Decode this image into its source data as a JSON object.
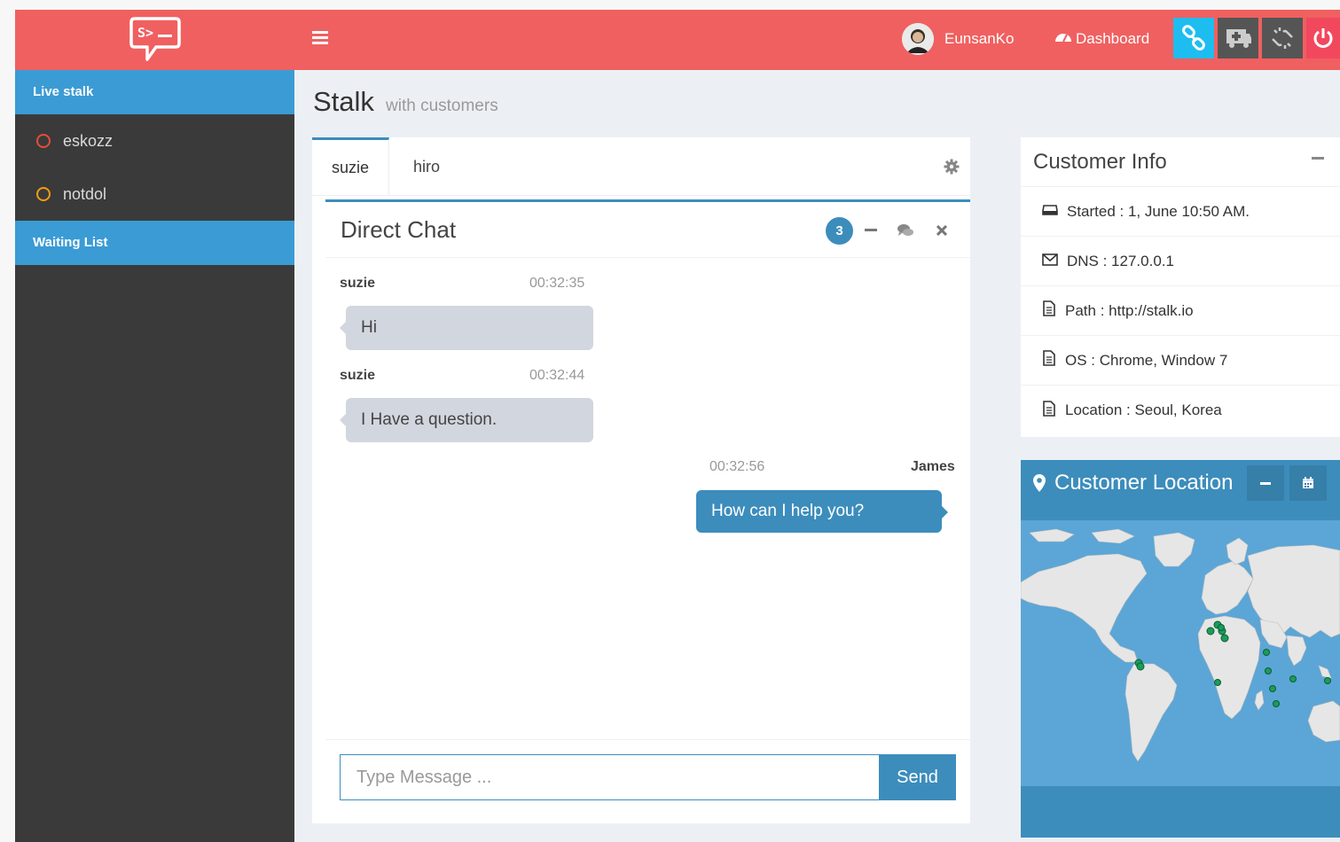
{
  "header": {
    "user_name": "EunsanKo",
    "dashboard_label": "Dashboard",
    "accent_color": "#f06060"
  },
  "sidebar": {
    "live_stalk_label": "Live stalk",
    "users": [
      {
        "name": "eskozz",
        "status_color": "#e74c3c"
      },
      {
        "name": "notdol",
        "status_color": "#f39c12"
      }
    ],
    "waiting_list_label": "Waiting List"
  },
  "page": {
    "title": "Stalk",
    "subtitle": "with customers"
  },
  "tabs": [
    {
      "label": "suzie",
      "active": true
    },
    {
      "label": "hiro",
      "active": false
    }
  ],
  "chat": {
    "title": "Direct Chat",
    "badge_count": "3",
    "messages": [
      {
        "name": "suzie",
        "time": "00:32:35",
        "text": "Hi",
        "side": "left"
      },
      {
        "name": "suzie",
        "time": "00:32:44",
        "text": "I Have a question.",
        "side": "left"
      },
      {
        "name": "James",
        "time": "00:32:56",
        "text": "How can I help you?",
        "side": "right"
      }
    ],
    "input_placeholder": "Type Message ...",
    "send_label": "Send"
  },
  "customer_info": {
    "title": "Customer Info",
    "rows": [
      {
        "icon": "inbox-icon",
        "text": "Started : 1, June 10:50 AM."
      },
      {
        "icon": "envelope-icon",
        "text": "DNS : 127.0.0.1"
      },
      {
        "icon": "file-icon",
        "text": "Path : http://stalk.io"
      },
      {
        "icon": "file-icon",
        "text": "OS : Chrome, Window 7"
      },
      {
        "icon": "file-icon",
        "text": "Location : Seoul, Korea"
      }
    ]
  },
  "customer_location": {
    "title": "Customer Location",
    "zoom_in": "+",
    "zoom_out": "−"
  }
}
